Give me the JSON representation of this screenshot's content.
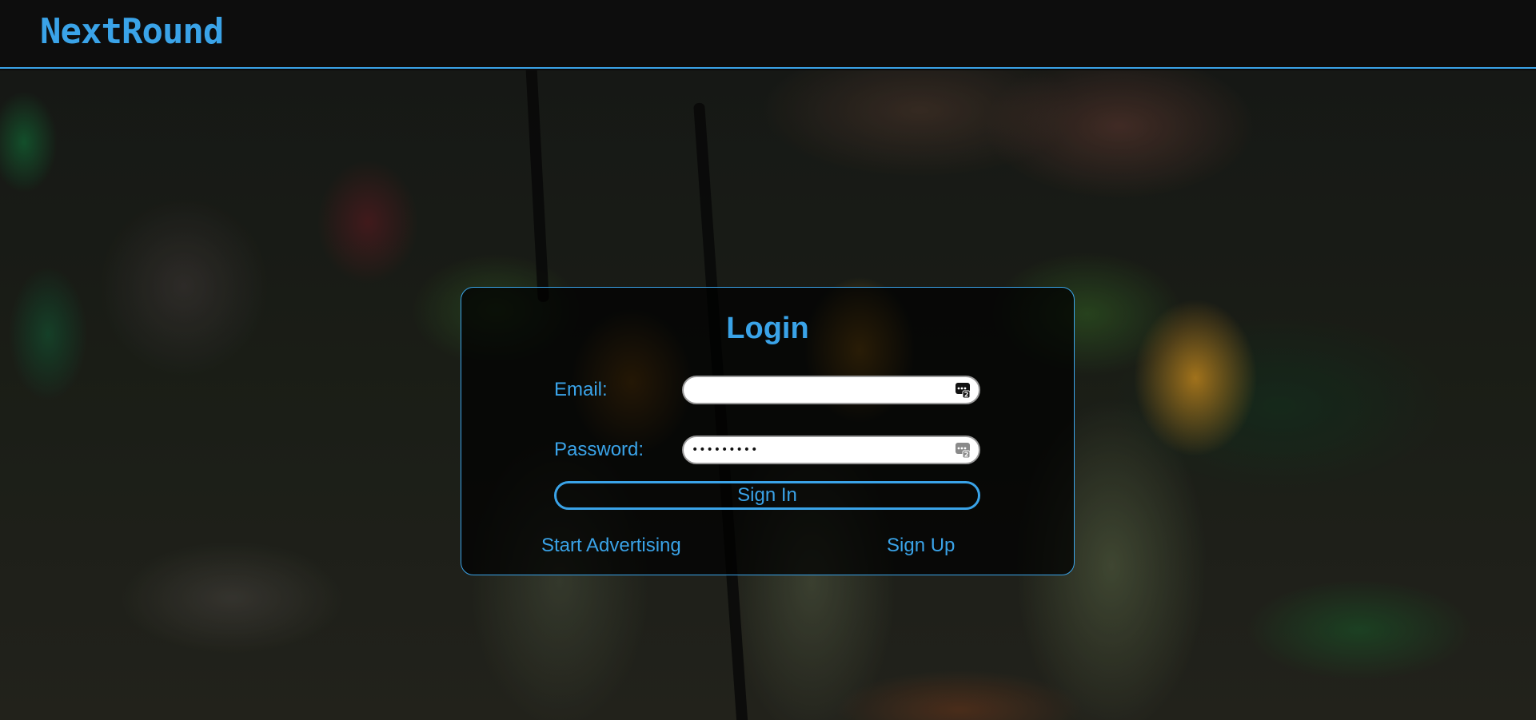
{
  "header": {
    "brand": "NextRound"
  },
  "login": {
    "title": "Login",
    "email_label": "Email:",
    "email_value": "",
    "password_label": "Password:",
    "password_value": "•••••••••",
    "signin_label": "Sign In",
    "start_advertising_label": "Start Advertising",
    "signup_label": "Sign Up"
  },
  "icons": {
    "field_icon": "password-manager-key-icon"
  },
  "colors": {
    "accent": "#3aa3e8",
    "header_bg": "#0d0d0d",
    "card_bg": "rgba(0,0,0,0.72)"
  }
}
